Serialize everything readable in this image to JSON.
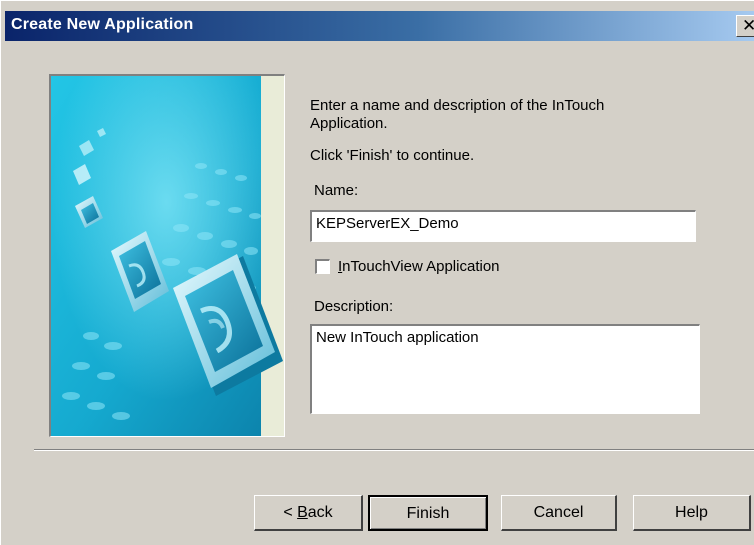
{
  "window": {
    "title": "Create New Application",
    "close_glyph": "✕"
  },
  "content": {
    "intro_line1": "Enter a name and description of the InTouch",
    "intro_line2": "Application.",
    "instruction": "Click 'Finish' to continue.",
    "name_label": "Name:",
    "name_value": "KEPServerEX_Demo",
    "checkbox_label_mnemonic": "I",
    "checkbox_label_rest": "nTouchView Application",
    "checkbox_checked": false,
    "description_label": "Description:",
    "description_value": "New InTouch application"
  },
  "buttons": {
    "back_prefix": "< ",
    "back_mnemonic": "B",
    "back_rest": "ack",
    "finish": "Finish",
    "cancel": "Cancel",
    "help": "Help"
  },
  "colors": {
    "dialog_bg": "#d4d0c8",
    "title_gradient_start": "#0a246a",
    "title_gradient_end": "#a6caf0",
    "art_cyan": "#1ab3d6"
  }
}
